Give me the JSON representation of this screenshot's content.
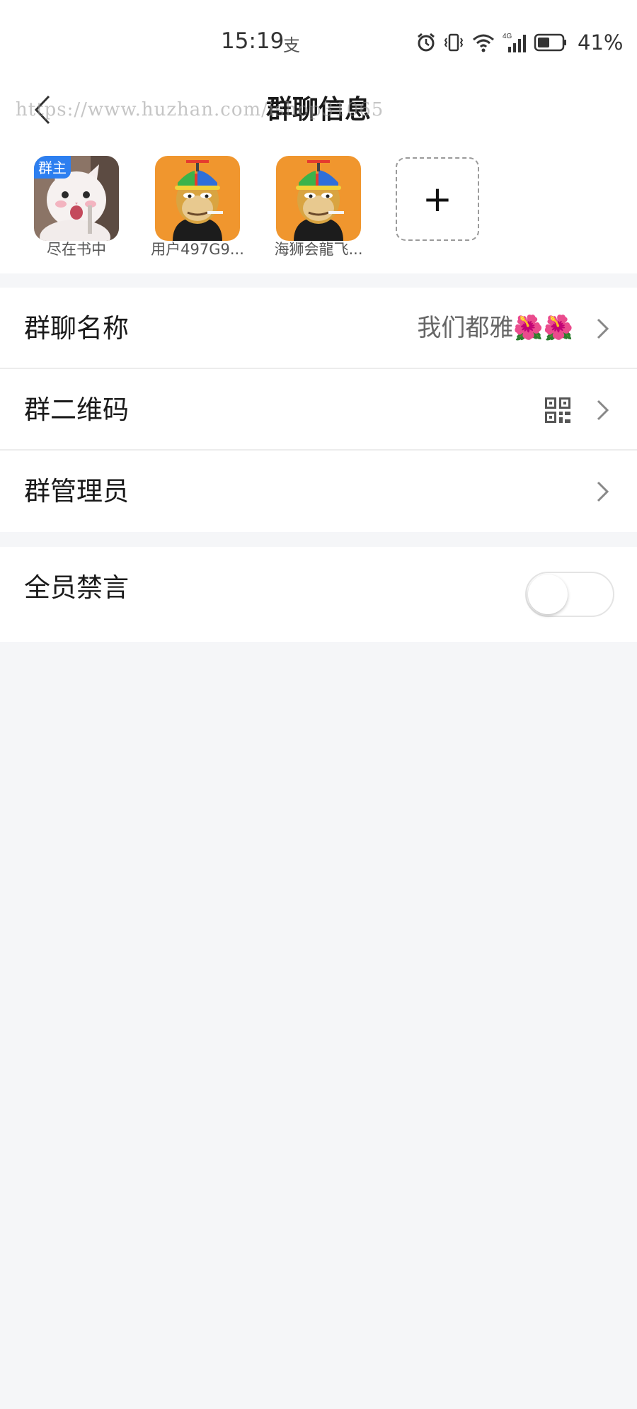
{
  "status_bar": {
    "time": "15:19",
    "app_indicator": "支",
    "battery_percent": "41%",
    "icons": [
      "alarm-icon",
      "vibrate-icon",
      "wifi-icon",
      "signal-4g-icon",
      "battery-icon"
    ]
  },
  "header": {
    "title": "群聊信息",
    "watermark": "https://www.huzhan.com/ishop31065"
  },
  "members": [
    {
      "name": "尽在书中",
      "badge": "群主",
      "avatar": "cat-avatar"
    },
    {
      "name": "用户497G9...",
      "badge": "",
      "avatar": "ape-avatar"
    },
    {
      "name": "海狮会龍飞...",
      "badge": "",
      "avatar": "ape-avatar"
    }
  ],
  "add_member_label": "+",
  "settings": {
    "group_name": {
      "label": "群聊名称",
      "value": "我们都雅🌺🌺"
    },
    "group_qr": {
      "label": "群二维码",
      "icon": "qr-code-icon"
    },
    "group_admin": {
      "label": "群管理员"
    },
    "mute_all": {
      "label": "全员禁言",
      "enabled": false
    }
  },
  "colors": {
    "owner_badge": "#2d7ff0",
    "avatar_orange": "#f0962e",
    "background": "#f5f6f8"
  }
}
